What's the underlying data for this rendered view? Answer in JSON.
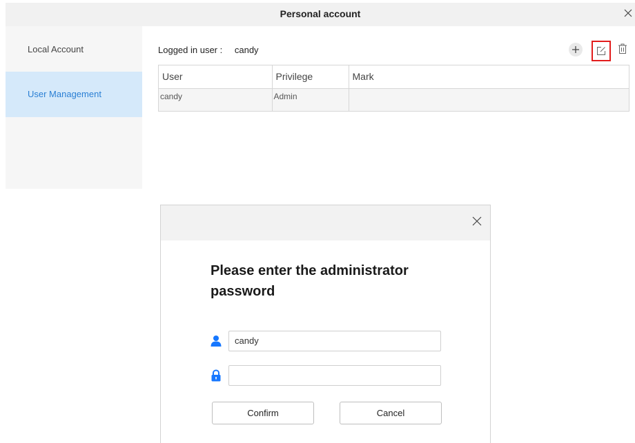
{
  "window": {
    "title": "Personal account",
    "close_glyph": "✕"
  },
  "sidebar": {
    "items": [
      {
        "label": "Local Account",
        "active": false
      },
      {
        "label": "User Management",
        "active": true
      }
    ]
  },
  "header": {
    "logged_label": "Logged in user :",
    "logged_user": "candy"
  },
  "toolbar": {
    "add_icon": "plus-icon",
    "edit_icon": "edit-icon",
    "delete_icon": "trash-icon"
  },
  "table": {
    "columns": [
      "User",
      "Privilege",
      "Mark"
    ],
    "rows": [
      [
        "candy",
        "Admin",
        ""
      ]
    ]
  },
  "dialog": {
    "close_glyph": "✕",
    "heading": "Please enter the administrator password",
    "username_value": "candy",
    "password_value": "",
    "confirm_label": "Confirm",
    "cancel_label": "Cancel"
  },
  "colors": {
    "accent": "#1677ff",
    "sidebar_active_bg": "#d5e9fa",
    "highlight": "#e21c1c"
  }
}
